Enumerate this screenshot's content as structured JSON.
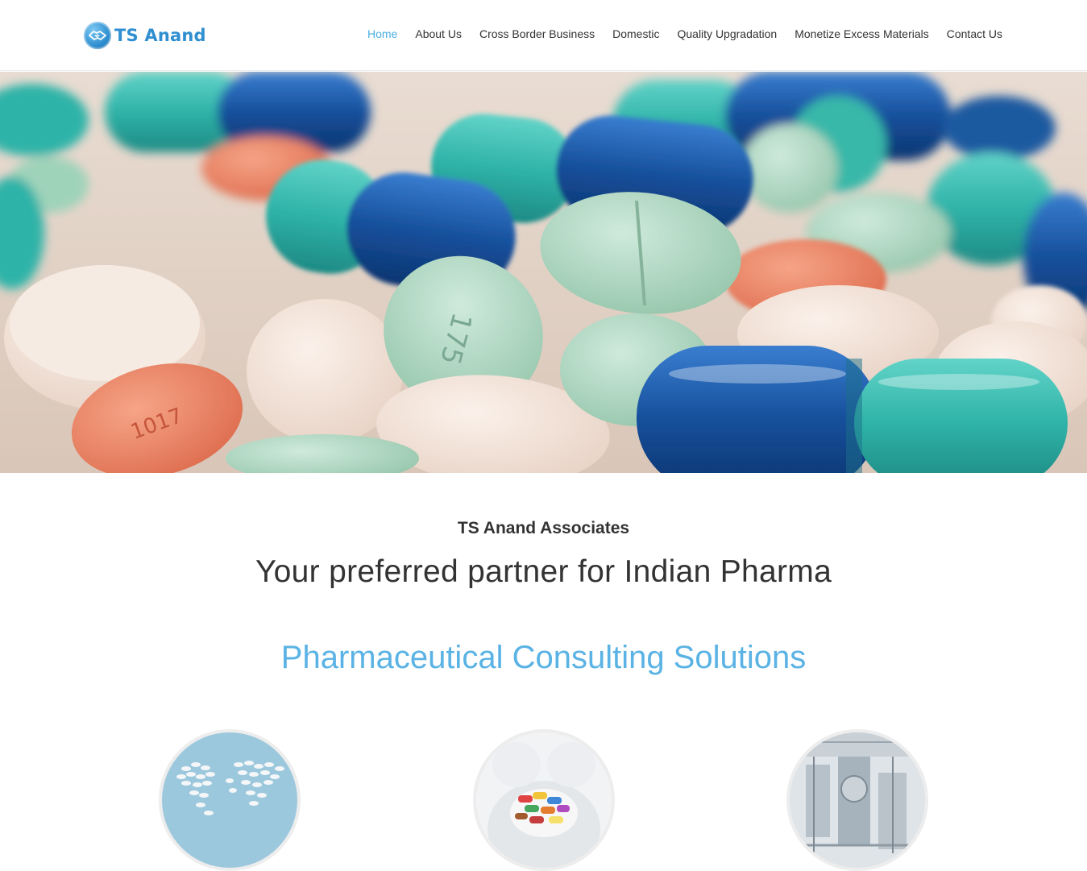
{
  "header": {
    "logo_text": "TS Anand",
    "nav": [
      {
        "label": "Home",
        "active": true
      },
      {
        "label": "About Us",
        "active": false
      },
      {
        "label": "Cross Border Business",
        "active": false
      },
      {
        "label": "Domestic",
        "active": false
      },
      {
        "label": "Quality Upgradation",
        "active": false
      },
      {
        "label": "Monetize Excess Materials",
        "active": false
      },
      {
        "label": "Contact Us",
        "active": false
      }
    ]
  },
  "hero": {
    "image": "pills-capsules-photo"
  },
  "intro": {
    "company": "TS Anand Associates",
    "tagline": "Your preferred partner for Indian Pharma",
    "section_title": "Pharmaceutical Consulting Solutions"
  },
  "services": [
    {
      "image": "pills-world-map-photo"
    },
    {
      "image": "hands-holding-pills-photo"
    },
    {
      "image": "pharma-factory-equipment-photo"
    }
  ],
  "colors": {
    "accent": "#5ab3e4",
    "nav_active": "#4aaee2",
    "logo": "#2f8fd0",
    "text": "#333333"
  }
}
